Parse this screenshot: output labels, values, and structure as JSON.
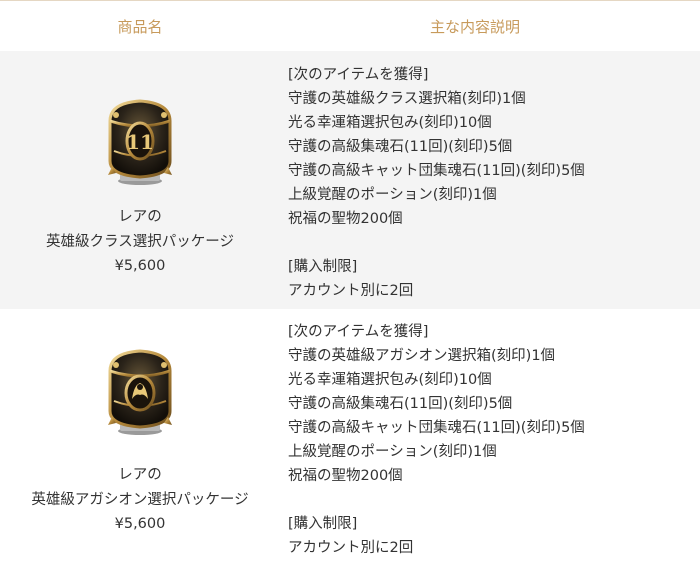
{
  "table": {
    "headers": {
      "name": "商品名",
      "description": "主な内容説明"
    },
    "rows": [
      {
        "rarity": "レアの",
        "product_name": "英雄級クラス選択パッケージ",
        "price": "¥5,600",
        "image_icon": "treasure-chest-class-emblem-icon",
        "contents_heading": "[次のアイテムを獲得]",
        "contents": [
          "守護の英雄級クラス選択箱(刻印)1個",
          "光る幸運箱選択包み(刻印)10個",
          "守護の高級集魂石(11回)(刻印)5個",
          "守護の高級キャット団集魂石(11回)(刻印)5個",
          "上級覚醒のポーション(刻印)1個",
          "祝福の聖物200個"
        ],
        "limit_heading": "[購入制限]",
        "limit_text": "アカウント別に2回"
      },
      {
        "rarity": "レアの",
        "product_name": "英雄級アガシオン選択パッケージ",
        "price": "¥5,600",
        "image_icon": "treasure-chest-agathion-emblem-icon",
        "contents_heading": "[次のアイテムを獲得]",
        "contents": [
          "守護の英雄級アガシオン選択箱(刻印)1個",
          "光る幸運箱選択包み(刻印)10個",
          "守護の高級集魂石(11回)(刻印)5個",
          "守護の高級キャット団集魂石(11回)(刻印)5個",
          "上級覚醒のポーション(刻印)1個",
          "祝福の聖物200個"
        ],
        "limit_heading": "[購入制限]",
        "limit_text": "アカウント別に2回"
      }
    ]
  },
  "colors": {
    "header_text": "#c79a5b",
    "row_gray": "#f4f4f4",
    "text": "#333333"
  }
}
